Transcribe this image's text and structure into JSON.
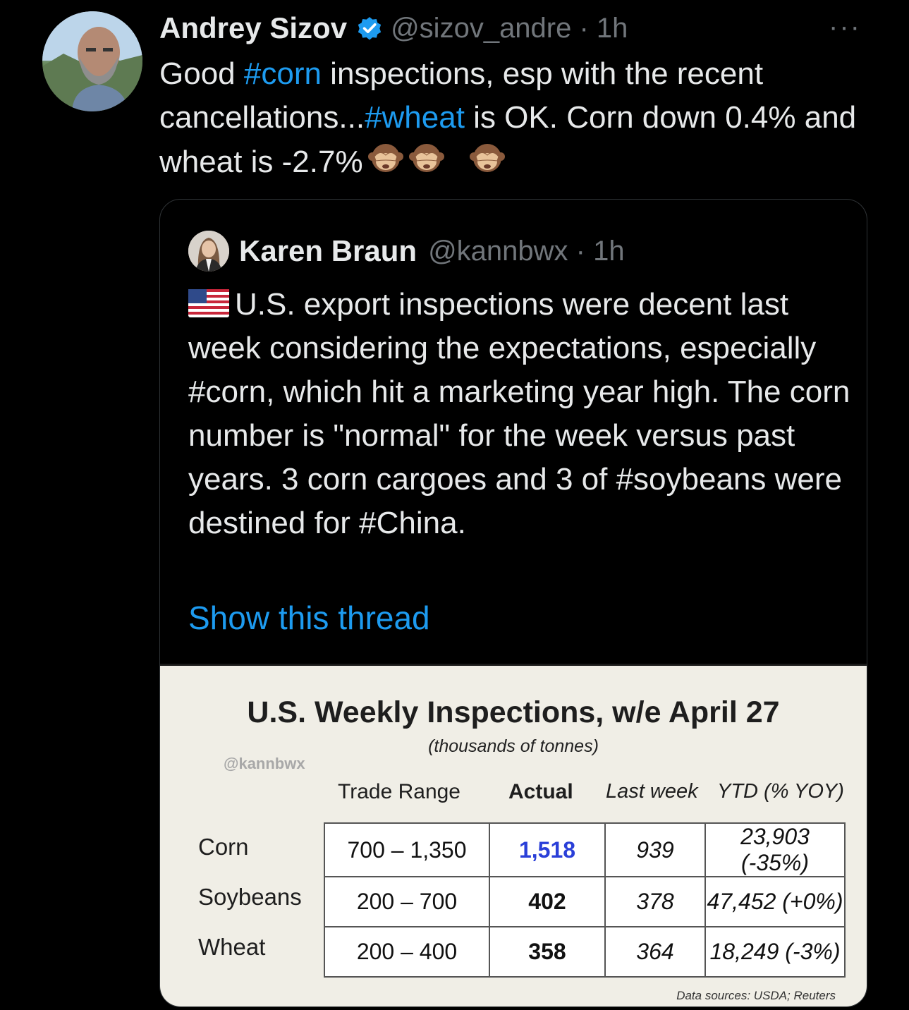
{
  "tweet": {
    "author_name": "Andrey Sizov",
    "handle_time": "@sizov_andre · 1h",
    "more": "···",
    "text": {
      "p1": "Good ",
      "tag_corn": "#corn",
      "p2": " inspections, esp with the recent cancellations...",
      "tag_wheat": "#wheat",
      "p3": " is OK. Corn down 0.4% and wheat is -2.7%"
    },
    "emojis": [
      "see-no-evil-monkey",
      "see-no-evil-monkey",
      "see-no-evil-monkey"
    ]
  },
  "quote": {
    "author_name": "Karen Braun",
    "handle_time": "@kannbwx · 1h",
    "text": {
      "p1": "U.S. export inspections were decent last week considering the expectations, especially #corn, which hit a marketing year high. The corn number is \"normal\" for the week versus past years. 3 corn cargoes and 3 of #soybeans were destined for #China."
    },
    "show_thread": "Show this thread",
    "flag_icon": "us-flag-icon"
  },
  "media": {
    "title": "U.S. Weekly Inspections, w/e April 27",
    "subtitle": "(thousands of tonnes)",
    "watermark": "@kannbwx",
    "columns": {
      "range": "Trade Range",
      "actual": "Actual",
      "last": "Last week",
      "ytd": "YTD (% YOY)"
    },
    "rows": [
      {
        "label": "Corn",
        "range": "700 – 1,350",
        "actual": "1,518",
        "last": "939",
        "ytd": "23,903 (-35%)"
      },
      {
        "label": "Soybeans",
        "range": "200 – 700",
        "actual": "402",
        "last": "378",
        "ytd": "47,452 (+0%)"
      },
      {
        "label": "Wheat",
        "range": "200 – 400",
        "actual": "358",
        "last": "364",
        "ytd": "18,249 (-3%)"
      }
    ],
    "sources": "Data sources: USDA; Reuters",
    "highlight_color": "#2a3fd8"
  },
  "colors": {
    "background": "#000000",
    "text": "#e7e9ea",
    "muted": "#71767b",
    "link": "#1d9bf0",
    "verified": "#1d9bf0"
  }
}
